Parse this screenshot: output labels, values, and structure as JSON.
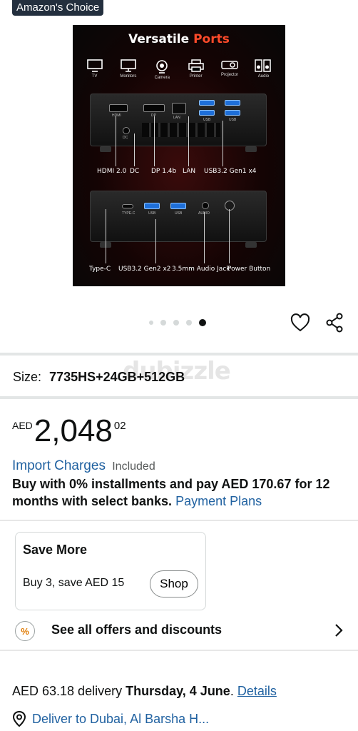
{
  "badge": {
    "label": "Amazon's Choice"
  },
  "product_image": {
    "title_part1": "Versatile",
    "title_part2": "Ports",
    "devices": [
      {
        "icon": "tv-icon",
        "label": "TV"
      },
      {
        "icon": "monitor-icon",
        "label": "Monitors"
      },
      {
        "icon": "camera-icon",
        "label": "Camera"
      },
      {
        "icon": "printer-icon",
        "label": "Printer"
      },
      {
        "icon": "projector-icon",
        "label": "Projector"
      },
      {
        "icon": "speaker-icon",
        "label": "Audio"
      }
    ],
    "port_labels": {
      "hdmi": "HDMI 2.0",
      "dc": "DC",
      "dp": "DP 1.4b",
      "lan": "LAN",
      "usb_gen1": "USB3.2 Gen1 x4",
      "typec": "Type-C",
      "usb_gen2": "USB3.2 Gen2 x2",
      "audio": "3.5mm Audio Jack",
      "power": "Power Button"
    },
    "small_labels": {
      "hdmi": "HDMI",
      "dp": "DP",
      "lan": "LAN",
      "usb": "USB",
      "dc": "DC",
      "typec": "TYPE-C",
      "audio": "AUDIO"
    }
  },
  "carousel": {
    "total_images": 5,
    "active_index": 4
  },
  "watermark": "dubizzle",
  "size": {
    "label": "Size:",
    "value": "7735HS+24GB+512GB"
  },
  "price": {
    "currency": "AED",
    "whole": "2,048",
    "fraction": "02"
  },
  "import_charges": {
    "link": "Import Charges",
    "status": "Included"
  },
  "installments": {
    "text": "Buy with 0% installments and pay AED 170.67 for 12 months with select banks.",
    "link": "Payment Plans"
  },
  "save_more": {
    "title": "Save More",
    "description": "Buy 3, save AED 15",
    "button": "Shop"
  },
  "offers": {
    "icon": "percent-icon",
    "label": "See all offers and discounts"
  },
  "delivery": {
    "prefix": "AED 63.18 delivery",
    "date": "Thursday, 4 June",
    "period": ".",
    "details_link": "Details"
  },
  "deliver_to": {
    "label": "Deliver to Dubai, Al Barsha H..."
  }
}
